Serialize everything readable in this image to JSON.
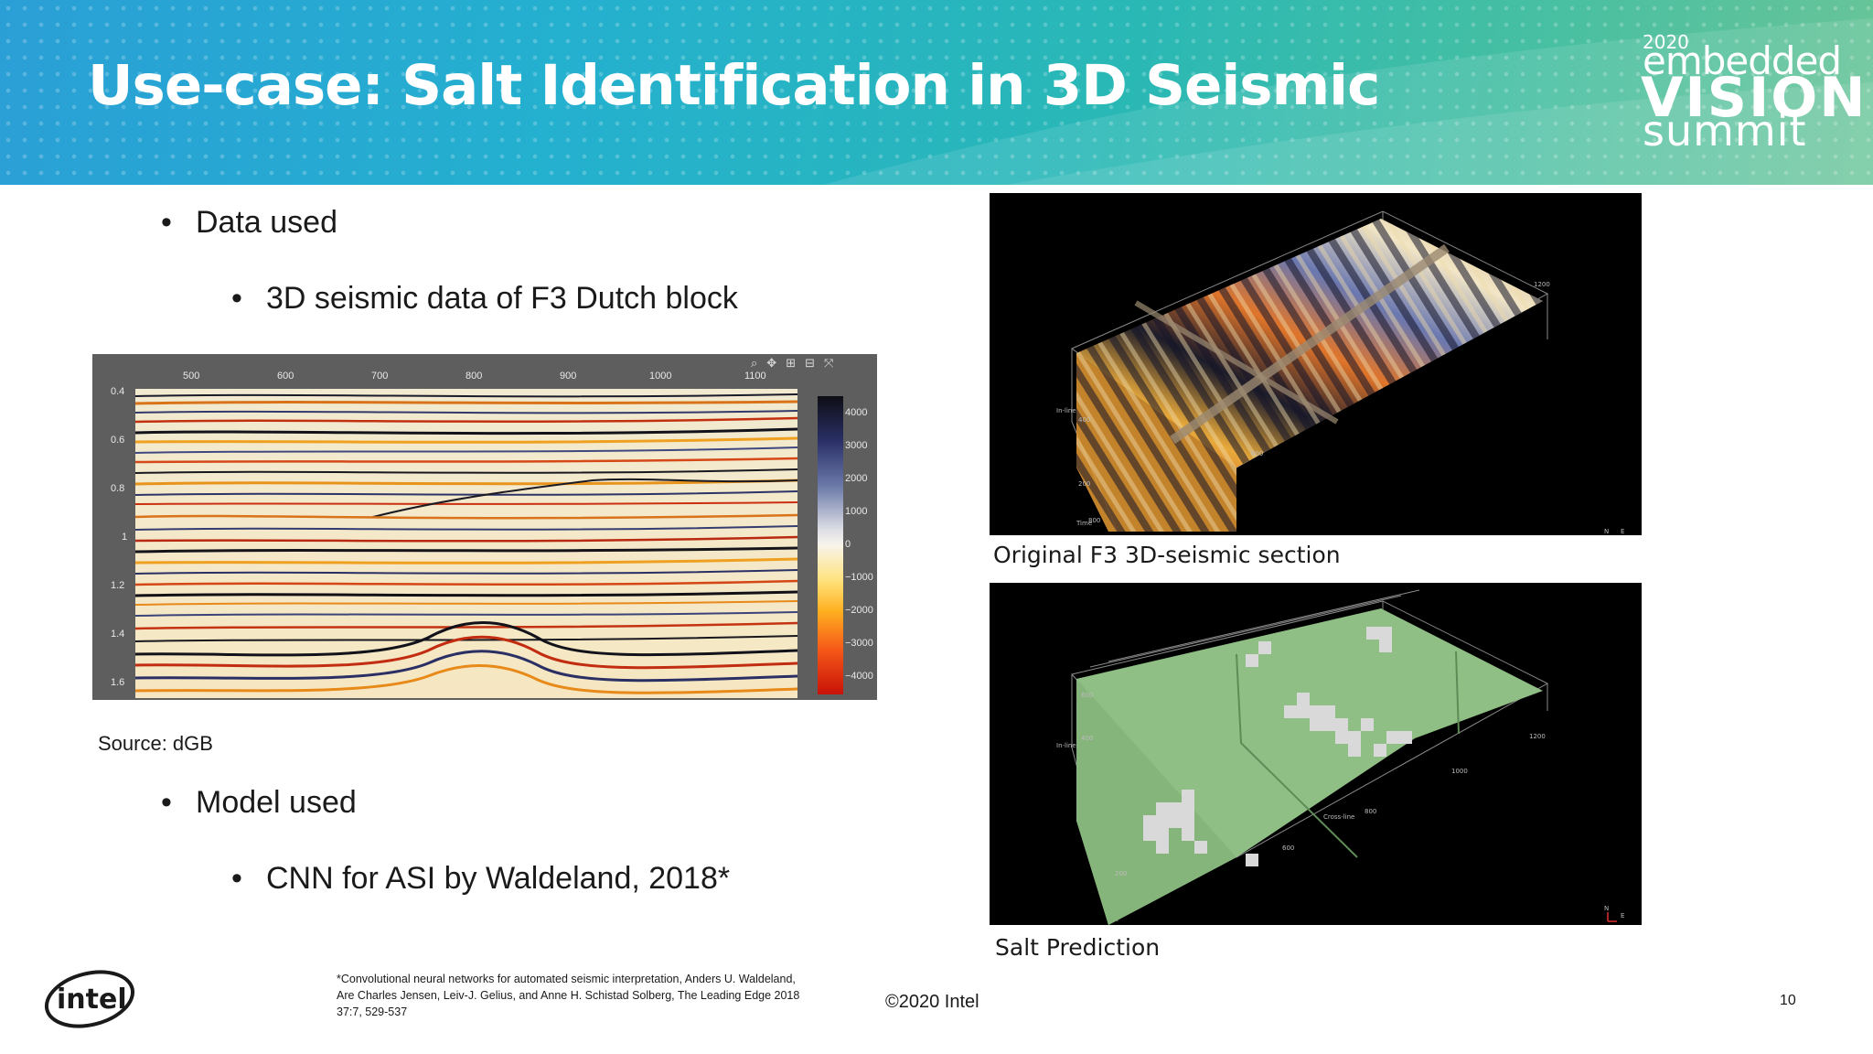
{
  "header": {
    "title": "Use-case: Salt Identification in 3D Seismic",
    "logo": {
      "year": "2020",
      "line1": "embedded",
      "line2": "VISION",
      "line3": "summit"
    },
    "colors": {
      "gradient_start": "#2a9fd6",
      "gradient_end": "#69c498"
    }
  },
  "content": {
    "bullet1": "Data used",
    "bullet1_sub": "3D seismic data of F3 Dutch block",
    "source": "Source: dGB",
    "bullet2": "Model used",
    "bullet2_sub": "CNN for ASI by Waldeland, 2018*",
    "bullet_char": "•"
  },
  "seismic_plot": {
    "x_ticks": [
      "500",
      "600",
      "700",
      "800",
      "900",
      "1000",
      "1100"
    ],
    "y_ticks": [
      "0.4",
      "0.6",
      "0.8",
      "1",
      "1.2",
      "1.4",
      "1.6"
    ],
    "colorbar_ticks": [
      "4000",
      "3000",
      "2000",
      "1000",
      "0",
      "−1000",
      "−2000",
      "−3000",
      "−4000"
    ],
    "toolbar_icons": [
      "zoom-icon",
      "pan-icon",
      "zoom-in-icon",
      "zoom-out-icon",
      "reset-icon"
    ]
  },
  "figures": {
    "top_caption": "Original F3 3D-seismic section",
    "bottom_caption": "Salt Prediction",
    "top_labels": {
      "inline": "In-line",
      "time": "Time",
      "t1200": "1200",
      "t600": "600",
      "t400": "400",
      "t200": "200",
      "t800": "800",
      "n": "N",
      "e": "E"
    },
    "bottom_labels": {
      "inline": "In-line",
      "crossline": "Cross-line",
      "t1200": "1200",
      "t1000": "1000",
      "t800": "800",
      "t600": "600",
      "t400": "400",
      "t200": "200",
      "n": "N",
      "e": "E"
    },
    "salt_color": "#8fbf85"
  },
  "footer": {
    "footnote": "*Convolutional neural networks for automated seismic interpretation, Anders U. Waldeland, Are Charles Jensen, Leiv-J. Gelius, and Anne H. Schistad Solberg, The Leading Edge 2018 37:7, 529-537",
    "copyright": "©2020 Intel",
    "page_number": "10",
    "brand": "intel"
  }
}
